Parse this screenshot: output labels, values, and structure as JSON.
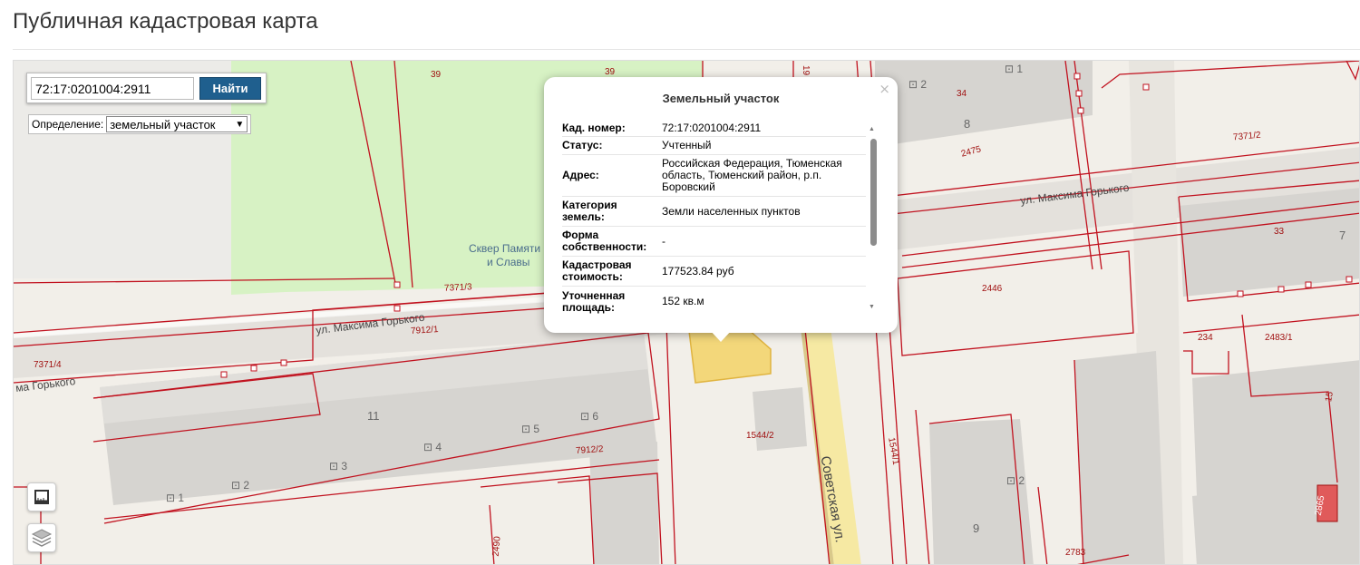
{
  "page": {
    "title": "Публичная кадастровая карта"
  },
  "search": {
    "value": "72:17:0201004:2911",
    "button_label": "Найти"
  },
  "definition": {
    "label": "Определение:",
    "selected": "земельный участок"
  },
  "popup": {
    "title": "Земельный участок",
    "close": "×",
    "rows": [
      {
        "key": "Кад. номер:",
        "value": "72:17:0201004:2911"
      },
      {
        "key": "Статус:",
        "value": "Учтенный"
      },
      {
        "key": "Адрес:",
        "value": "Российская Федерация, Тюменская область, Тюменский район, р.п. Боровский"
      },
      {
        "key": "Категория земель:",
        "value": "Земли населенных пунктов"
      },
      {
        "key": "Форма собственности:",
        "value": "-"
      },
      {
        "key": "Кадастровая стоимость:",
        "value": "177523.84 руб"
      },
      {
        "key": "Уточненная площадь:",
        "value": "152 кв.м"
      }
    ]
  },
  "map": {
    "streets": [
      "ул. Максима Горького",
      "ул. Максима Горького",
      "ма Горького",
      "Советская ул."
    ],
    "poi": [
      "Сквер Памяти",
      "и Славы"
    ],
    "building_numbers": [
      "11",
      "8",
      "9",
      "7",
      "1",
      "2",
      "3",
      "4",
      "5",
      "6",
      "1",
      "2",
      "2"
    ],
    "parcel_labels": [
      "39",
      "39",
      "19",
      "34",
      "7371/2",
      "2475",
      "33",
      "7371/3",
      "2446",
      "7912/1",
      "7371/4",
      "234",
      "2483/1",
      "15",
      "1544/2",
      "7912/2",
      "1544/1",
      "2490",
      "2783",
      "2865"
    ]
  }
}
